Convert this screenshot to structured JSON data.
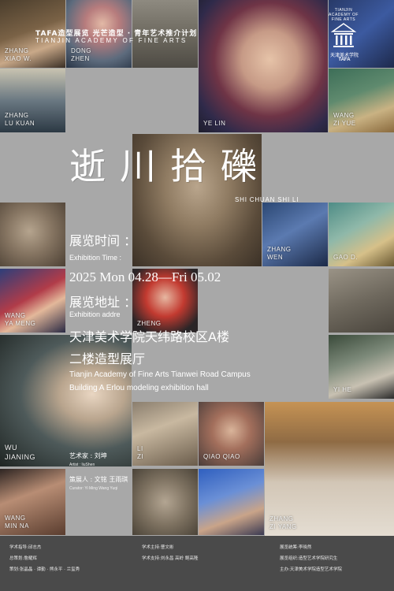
{
  "header": {
    "title_cn": "TAFA造型展览 光芒造型 · 青年艺术推介计划",
    "title_en": "TIANJIN ACADEMY OF FINE ARTS"
  },
  "logo": {
    "arc_text": "TIANJIN ACADEMY OF FINE ARTS",
    "name_cn": "天津美术学院",
    "abbr": "TAFA"
  },
  "exhibition": {
    "title_cn": "逝川拾礫",
    "title_en": "SHI CHUAN SHI LI",
    "time_label_cn": "展览时间 ：",
    "time_label_en": "Exhibition Time :",
    "dates": "2025  Mon 04.28—Fri 05.02",
    "address_label_cn": "展览地址 ：",
    "address_label_en": "Exhibition addre",
    "address_cn_line1": "天津美术学院天纬路校区A楼",
    "address_cn_line2": "二楼造型展厅",
    "address_en_line1": "Tianjin Academy of Fine Arts Tianwei Road Campus",
    "address_en_line2": "Building A Erlou modeling exhibition hall",
    "artist_label": "艺术家 : 刘坤",
    "artist_en": "Artist : liuShen",
    "curator_label": "策展人 : 文铭  王雨琪",
    "curator_en": "Curator: Yi Ming Wang Yuqi"
  },
  "artists": [
    {
      "first": "ZHANG",
      "second": "XIAO W."
    },
    {
      "first": "DONG",
      "second": "ZHEN"
    },
    {
      "first": "ZHANG",
      "second": "LU KUAN"
    },
    {
      "first": "YE LIN",
      "second": ""
    },
    {
      "first": "WANG",
      "second": "ZI YUE"
    },
    {
      "first": "ZHANG",
      "second": "WEN"
    },
    {
      "first": "GAO D.",
      "second": ""
    },
    {
      "first": "WANG",
      "second": "YA MENG"
    },
    {
      "first": "ZHENG",
      "second": ""
    },
    {
      "first": "WU",
      "second": "JIANING"
    },
    {
      "first": "YI HE",
      "second": ""
    },
    {
      "first": "LI",
      "second": "ZI"
    },
    {
      "first": "QIAO QIAO",
      "second": ""
    },
    {
      "first": "WANG",
      "second": "MIN NA"
    },
    {
      "first": "ZHANG",
      "second": "ZI YANG"
    }
  ],
  "footer": {
    "col1": [
      "学术指导:邱志杰",
      "总策划:詹耀辉",
      "策划:张晶晶 · 谭勤 · 熊永平 · 兰玺秀"
    ],
    "col2": [
      "学术主持:曹文彬",
      "学术支持:刘永昌  高岭  鲍高隆"
    ],
    "col3": [
      "展览统筹:李晓然",
      "展览组织:造型艺术学院研究生",
      "主办:天津美术学院造型艺术学院"
    ]
  }
}
